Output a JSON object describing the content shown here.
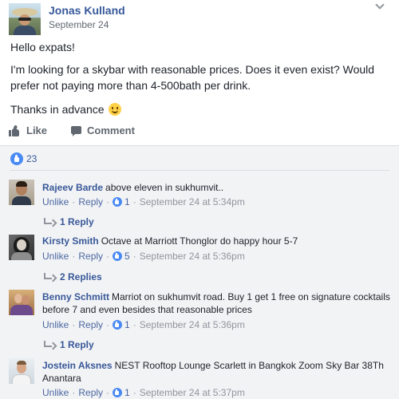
{
  "post": {
    "author": "Jonas Kulland",
    "date": "September 24",
    "paragraphs": {
      "greeting": "Hello expats!",
      "question": "I'm looking for a skybar with reasonable prices. Does it even exist? Would prefer not paying more than 4-500bath per drink.",
      "thanks": "Thanks in advance"
    },
    "actions": {
      "like": "Like",
      "comment": "Comment"
    },
    "reaction_count": "23"
  },
  "comments": [
    {
      "author": "Rajeev Barde",
      "text": "above eleven in sukhumvit..",
      "unlike": "Unlike",
      "reply": "Reply",
      "likes": "1",
      "time": "September 24 at 5:34pm",
      "replies": "1 Reply"
    },
    {
      "author": "Kirsty Smith",
      "text": "Octave at Marriott Thonglor do happy hour 5-7",
      "unlike": "Unlike",
      "reply": "Reply",
      "likes": "5",
      "time": "September 24 at 5:36pm",
      "replies": "2 Replies"
    },
    {
      "author": "Benny Schmitt",
      "text": "Marriot on sukhumvit road. Buy 1 get 1 free on signature cocktails before 7 and even besides that reasonable prices",
      "unlike": "Unlike",
      "reply": "Reply",
      "likes": "1",
      "time": "September 24 at 5:36pm",
      "replies": "1 Reply"
    },
    {
      "author": "Jostein Aksnes",
      "text": "NEST Rooftop Lounge Scarlett in Bangkok Zoom Sky Bar 38Th Anantara",
      "unlike": "Unlike",
      "reply": "Reply",
      "likes": "1",
      "time": "September 24 at 5:37pm"
    }
  ],
  "colors": {
    "link_blue": "#365899",
    "muted_gray": "#90949c",
    "feedback_bg": "#f2f3f5",
    "like_blue": "#4a8af4"
  },
  "icons": {
    "post_menu": "chevron-down-icon",
    "like": "thumbs-up-icon",
    "comment": "speech-bubble-icon",
    "reaction": "like-reaction-icon",
    "reply_arrow": "reply-arrow-icon",
    "emoji": "smiley-emoji-icon"
  }
}
